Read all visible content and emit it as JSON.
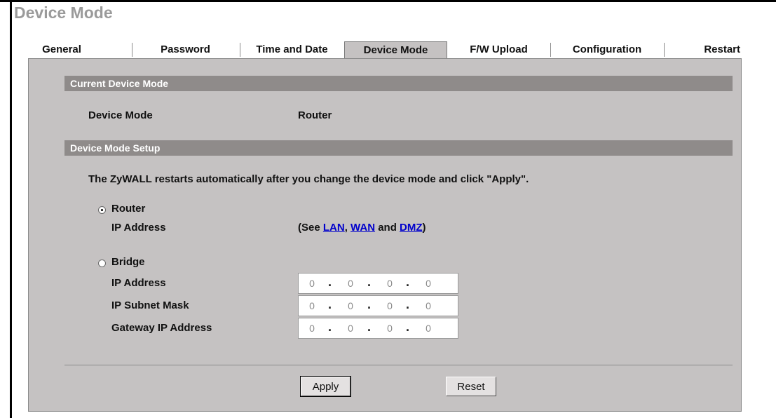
{
  "page": {
    "title": "Device Mode"
  },
  "tabs": [
    {
      "label": "General"
    },
    {
      "label": "Password"
    },
    {
      "label": "Time and Date"
    },
    {
      "label": "Device Mode",
      "active": true
    },
    {
      "label": "F/W Upload"
    },
    {
      "label": "Configuration"
    },
    {
      "label": "Restart"
    }
  ],
  "current": {
    "header": "Current Device Mode",
    "mode_label": "Device Mode",
    "mode_value": "Router"
  },
  "setup": {
    "header": "Device Mode Setup",
    "notice": "The ZyWALL restarts automatically after you change the device mode and click \"Apply\".",
    "router": {
      "label": "Router",
      "selected": true,
      "ip_label": "IP Address",
      "see_prefix": "(See ",
      "lan": "LAN",
      "sep1": ", ",
      "wan": "WAN",
      "and": " and ",
      "dmz": "DMZ",
      "suffix": ")"
    },
    "bridge": {
      "label": "Bridge",
      "selected": false,
      "ip_label": "IP Address",
      "ip": [
        "0",
        "0",
        "0",
        "0"
      ],
      "mask_label": "IP Subnet Mask",
      "mask": [
        "0",
        "0",
        "0",
        "0"
      ],
      "gateway_label": "Gateway IP Address",
      "gateway": [
        "0",
        "0",
        "0",
        "0"
      ]
    }
  },
  "buttons": {
    "apply": "Apply",
    "reset": "Reset"
  },
  "colors": {
    "panel": "#c5c2c2",
    "section_bar": "#8f8b8a",
    "link": "#0000cc",
    "title": "#9a9a9a"
  }
}
